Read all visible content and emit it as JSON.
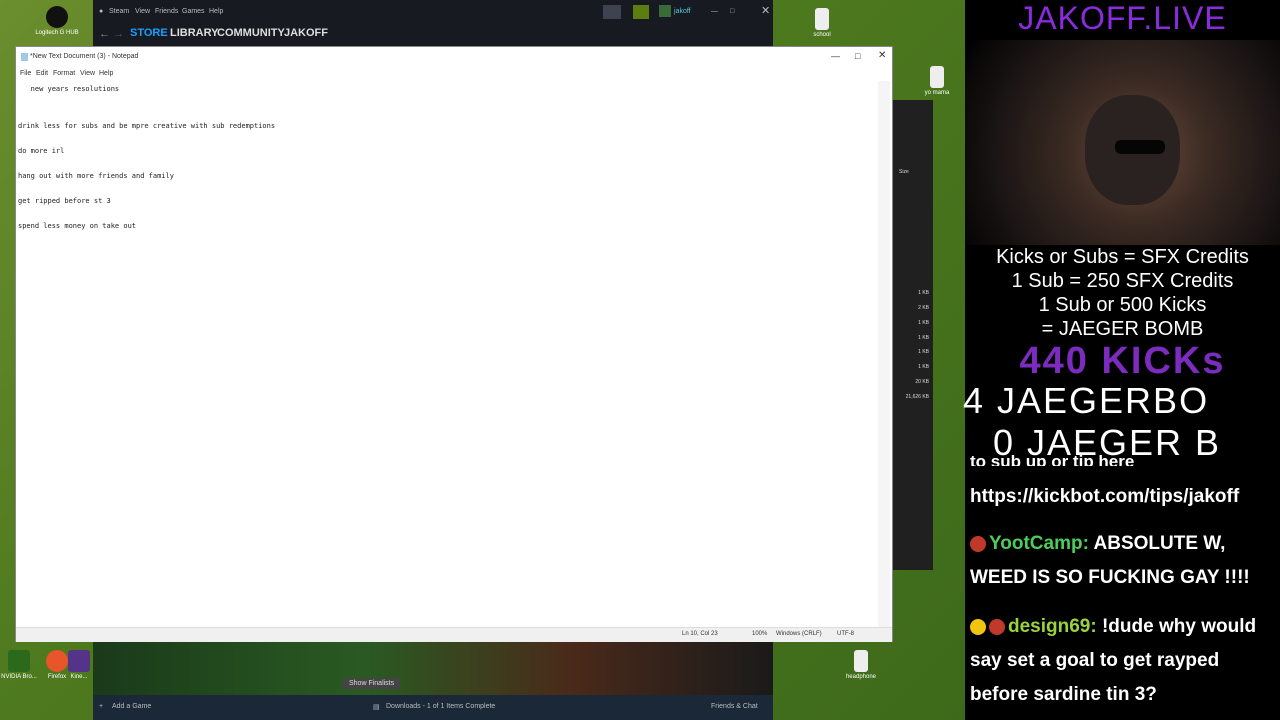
{
  "desktop": {
    "icons": [
      {
        "label": "Logitech G HUB"
      },
      {
        "label": "school"
      },
      {
        "label": "yo mama"
      },
      {
        "label": "NVIDIA Bro..."
      },
      {
        "label": "Firefox"
      },
      {
        "label": "Kine..."
      },
      {
        "label": "headphone"
      }
    ]
  },
  "steam": {
    "menu": [
      "Steam",
      "View",
      "Friends",
      "Games",
      "Help"
    ],
    "user": "jakoff",
    "tabs": [
      "STORE",
      "LIBRARY",
      "COMMUNITY",
      "JAKOFF"
    ],
    "game_banner_button": "Show Finalists",
    "bottom": {
      "add_game": "Add a Game",
      "downloads": "Downloads - 1 of 1 Items Complete",
      "friends_chat": "Friends & Chat"
    }
  },
  "explorer": {
    "size_header": "Size",
    "sizes": [
      "1 KB",
      "2 KB",
      "1 KB",
      "1 KB",
      "1 KB",
      "1 KB",
      "20 KB",
      "21,626 KB"
    ]
  },
  "notepad": {
    "title": "*New Text Document (3) - Notepad",
    "menu": [
      "File",
      "Edit",
      "Format",
      "View",
      "Help"
    ],
    "lines": [
      "   new years resolutions",
      "drink less for subs and be mpre creative with sub redemptions",
      "do more irl",
      "hang out with more friends and family",
      "get ripped before st 3",
      "spend less money on take out"
    ],
    "status": {
      "position": "Ln 10, Col 23",
      "zoom": "100%",
      "line_ending": "Windows (CRLF)",
      "encoding": "UTF-8"
    }
  },
  "overlay": {
    "brand": "JAKOFF.LIVE",
    "credits": [
      "Kicks or Subs = SFX Credits",
      "1 Sub = 250 SFX Credits",
      "1 Sub or 500 Kicks",
      "= JAEGER BOMB"
    ],
    "kicks": "440 KICKs",
    "jaegerbombs": "4 JAEGERBO",
    "jaeger_done": "0 JAEGER B",
    "tip_line": "to sub up or tip here",
    "tip_url": "https://kickbot.com/tips/jakoff",
    "chat": [
      {
        "user": "YootCamp:",
        "message": "ABSOLUTE W, WEED IS SO FUCKING GAY !!!!"
      },
      {
        "user": "design69:",
        "message": "!dude why would say set a goal to get rayped before sardine tin 3?"
      }
    ]
  }
}
